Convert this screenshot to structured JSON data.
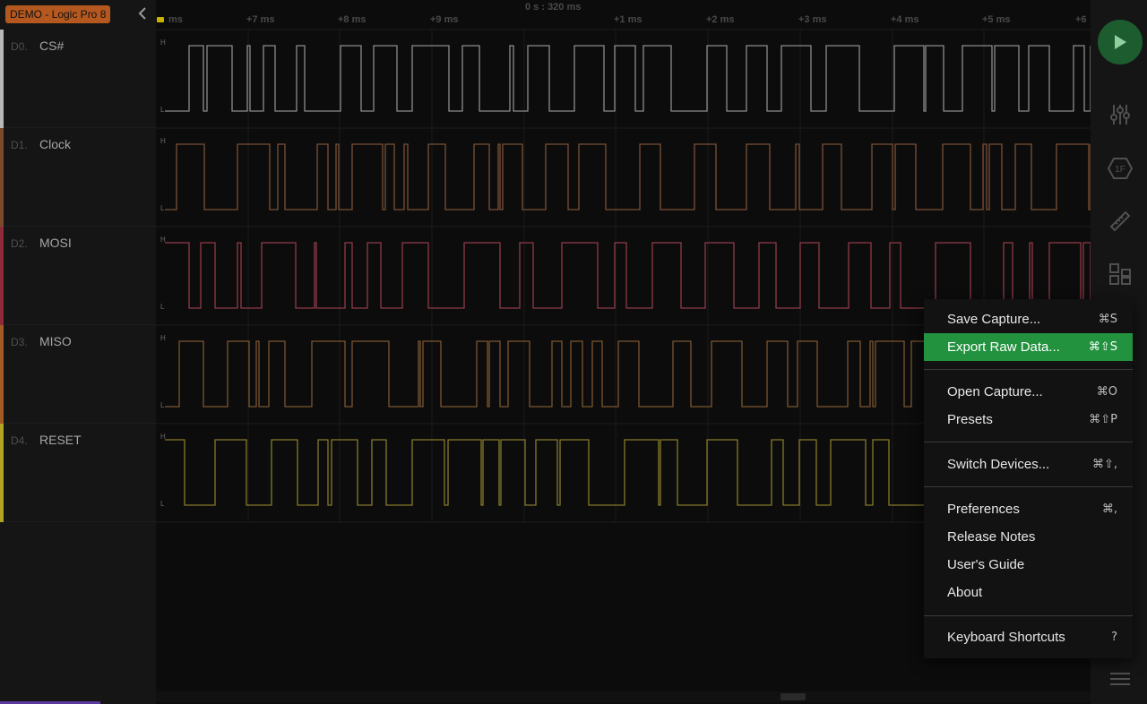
{
  "device": {
    "badge": "DEMO - Logic Pro 8"
  },
  "channels": [
    {
      "index": "D0.",
      "name": "CS#",
      "color": "#b8b8b8",
      "wave": "#8c8c8c"
    },
    {
      "index": "D1.",
      "name": "Clock",
      "color": "#7a4a2a",
      "wave": "#7a5036"
    },
    {
      "index": "D2.",
      "name": "MOSI",
      "color": "#8e2a3a",
      "wave": "#8f3b48"
    },
    {
      "index": "D3.",
      "name": "MISO",
      "color": "#a35a23",
      "wave": "#7c5530"
    },
    {
      "index": "D4.",
      "name": "RESET",
      "color": "#b2a425",
      "wave": "#857a2a"
    }
  ],
  "levels": {
    "high": "H",
    "low": "L"
  },
  "timeline": {
    "center": "0 s : 320 ms",
    "labels": [
      "ms",
      "+7 ms",
      "+8 ms",
      "+9 ms",
      "+1 ms",
      "+2 ms",
      "+3 ms",
      "+4 ms",
      "+5 ms",
      "+6"
    ]
  },
  "menu": {
    "groups": [
      [
        {
          "label": "Save Capture...",
          "shortcut": "⌘S",
          "active": false
        },
        {
          "label": "Export Raw Data...",
          "shortcut": "⌘⇧S",
          "active": true
        }
      ],
      [
        {
          "label": "Open Capture...",
          "shortcut": "⌘O",
          "active": false
        },
        {
          "label": "Presets",
          "shortcut": "⌘⇧P",
          "active": false
        }
      ],
      [
        {
          "label": "Switch Devices...",
          "shortcut": "⌘⇧,",
          "active": false
        }
      ],
      [
        {
          "label": "Preferences",
          "shortcut": "⌘,",
          "active": false
        },
        {
          "label": "Release Notes",
          "shortcut": "",
          "active": false
        },
        {
          "label": "User's Guide",
          "shortcut": "",
          "active": false
        },
        {
          "label": "About",
          "shortcut": "",
          "active": false
        }
      ],
      [
        {
          "label": "Keyboard Shortcuts",
          "shortcut": "?",
          "active": false
        }
      ]
    ]
  },
  "colors": {
    "accent": "#22923f",
    "play": "#1d5c2e",
    "badge": "#b5581f"
  },
  "toolbar_icons": [
    "play-icon",
    "sliders-icon",
    "hex-1f-icon",
    "ruler-icon",
    "extensions-icon",
    "hamburger-menu-icon"
  ],
  "toolbar_text": {
    "hex": "1F"
  }
}
